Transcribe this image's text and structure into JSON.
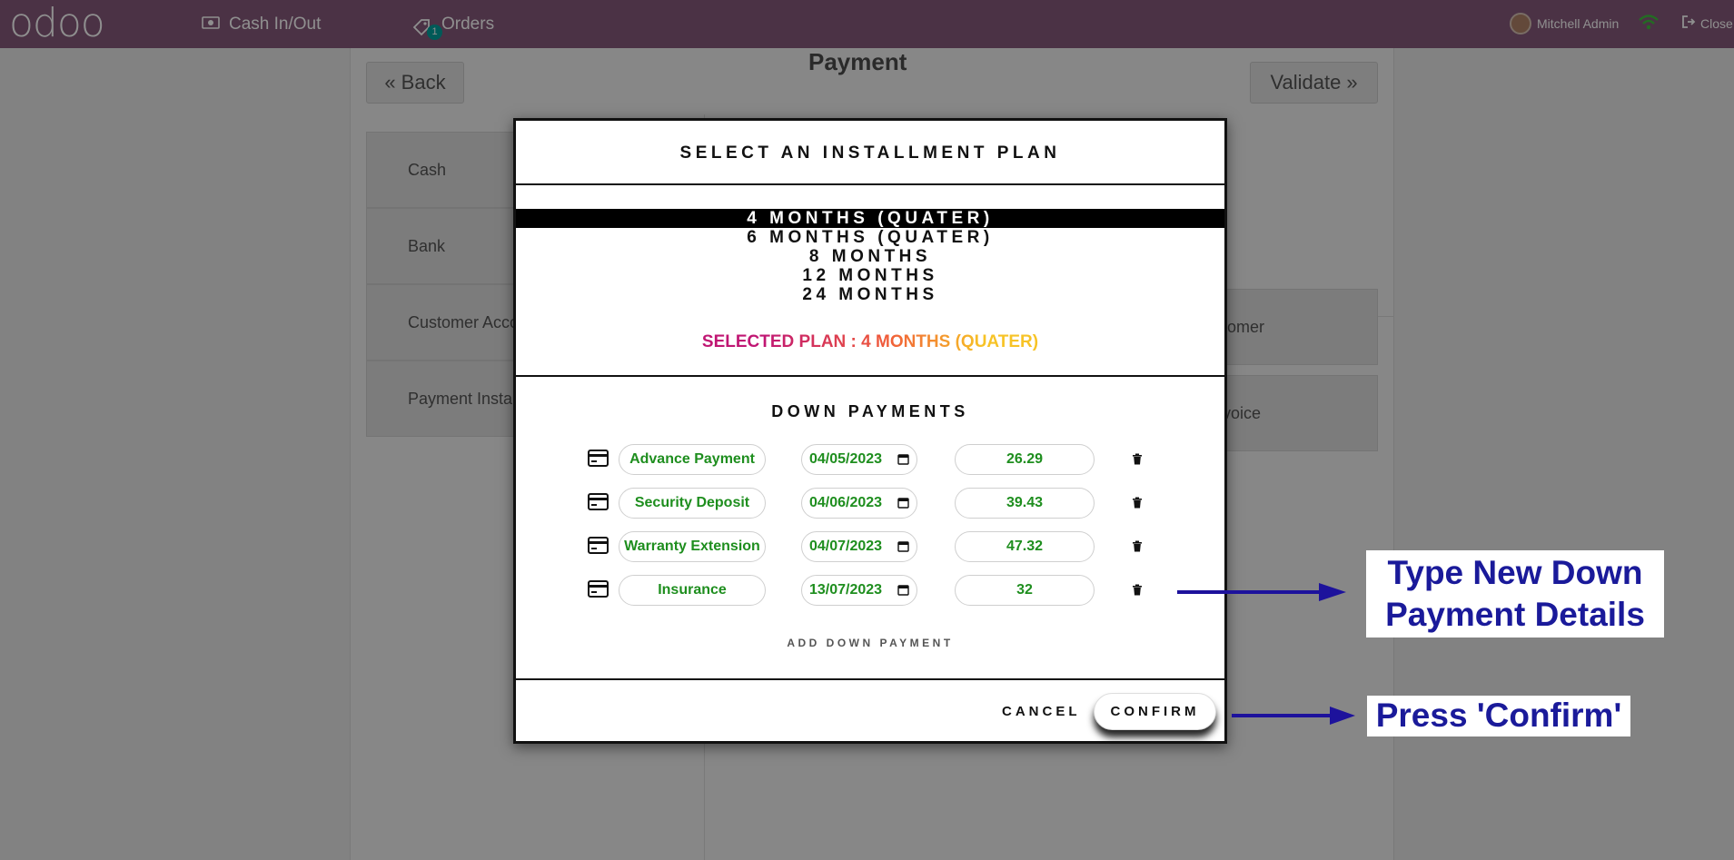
{
  "topbar": {
    "logo": "odoo",
    "cash_in_out": "Cash In/Out",
    "orders": "Orders",
    "orders_badge": "1",
    "user": "Mitchell Admin",
    "close": "Close"
  },
  "background": {
    "title": "Payment",
    "back": "Back",
    "validate": "Validate",
    "payment_methods": [
      "Cash",
      "Bank",
      "Customer Acco",
      "Payment Insta"
    ],
    "customer_btn": "tomer",
    "invoice_btn": "voice"
  },
  "modal": {
    "title": "SELECT AN INSTALLMENT PLAN",
    "plans": [
      "4 MONTHS (QUATER)",
      "6 MONTHS (QUATER)",
      "8 MONTHS",
      "12 MONTHS",
      "24 MONTHS"
    ],
    "selected_index": 0,
    "selected_plan_text": "SELECTED PLAN : 4 MONTHS (QUATER)",
    "down_payments_title": "DOWN PAYMENTS",
    "down_payments": [
      {
        "name": "Advance Payment",
        "date": "04/05/2023",
        "amount": "26.29"
      },
      {
        "name": "Security Deposit",
        "date": "04/06/2023",
        "amount": "39.43"
      },
      {
        "name": "Warranty Extension",
        "date": "04/07/2023",
        "amount": "47.32"
      },
      {
        "name": "Insurance",
        "date": "13/07/2023",
        "amount": "32"
      }
    ],
    "add_down_payment": "ADD DOWN PAYMENT",
    "cancel": "CANCEL",
    "confirm": "CONFIRM"
  },
  "annotations": {
    "note1_line1": "Type New Down",
    "note1_line2": "Payment Details",
    "note2": "Press 'Confirm'"
  },
  "colors": {
    "topbar": "#875a7b",
    "value_text": "#1e8e1e",
    "annotation_text": "#1a1a9a",
    "annotation_arrow": "#1d129c"
  }
}
